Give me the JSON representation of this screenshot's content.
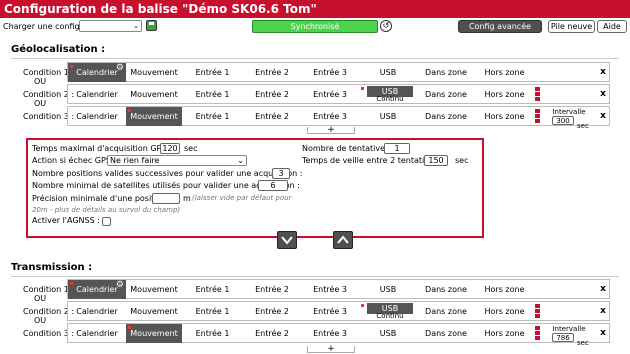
{
  "title": "Configuration de la balise \"Démo SK06.6 Tom\"",
  "toolbar": {
    "charger_label": "Charger une config. :",
    "config_select_value": "",
    "sync_label": "Synchronisé",
    "config_avancee": "Config avancée",
    "pile_neuve": "Pile neuve",
    "aide": "Aide"
  },
  "geolocalisation": {
    "title": "Géolocalisation :",
    "rows": [
      {
        "label": "Condition 1 :",
        "active": "Calendrier"
      },
      {
        "label": "Condition 2 :",
        "active": "USB",
        "sub": "Continu"
      },
      {
        "label": "Condition 3 :",
        "active": "Mouvement",
        "intervalle": "Intervalle",
        "value": "300",
        "unit": "sec"
      }
    ],
    "ou": "OU"
  },
  "conditions": [
    "Calendrier",
    "Mouvement",
    "Entrée 1",
    "Entrée 2",
    "Entrée 3",
    "USB",
    "Dans zone",
    "Hors zone"
  ],
  "params": {
    "temps_max_label": "Temps maximal d'acquisition GPS :",
    "temps_max_value": "120",
    "temps_max_unit": "sec",
    "nb_tentatives_label": "Nombre de tentatives :",
    "nb_tentatives_value": "1",
    "action_echec_label": "Action si échec GPS :",
    "action_echec_value": "Ne rien faire",
    "temps_veille_label": "Temps de veille entre 2 tentatives :",
    "temps_veille_value": "150",
    "temps_veille_unit": "sec",
    "nb_positions_label": "Nombre positions valides successives pour valider une acquisition :",
    "nb_positions_value": "3",
    "nb_satellites_label": "Nombre minimal de satellites utilisés pour valider une acquisition :",
    "nb_satellites_value": "6",
    "precision_label": "Précision minimale d'une position :",
    "precision_value": "",
    "precision_unit": "m",
    "precision_hint1": "(laisser vide par défaut pour",
    "precision_hint2": "20m - plus de détails au survol du champ)",
    "agnss_label": "Activer l'AGNSS :"
  },
  "transmission": {
    "title": "Transmission :",
    "rows": [
      {
        "label": "Condition 1 :",
        "active": "Calendrier"
      },
      {
        "label": "Condition 2 :",
        "active": "USB",
        "sub": "Continu"
      },
      {
        "label": "Condition 3 :",
        "active": "Mouvement",
        "intervalle": "Intervalle",
        "value": "786",
        "unit": "sec"
      }
    ],
    "ou": "OU"
  },
  "colors": {
    "accent": "#c8102e",
    "active_cell": "#555555",
    "sync": "#4cd44c"
  },
  "icons": {
    "save": "save-icon",
    "reset": "reset-icon",
    "gear": "gear-icon",
    "down": "arrow-down-icon",
    "up": "arrow-up-icon",
    "close": "close-icon"
  }
}
